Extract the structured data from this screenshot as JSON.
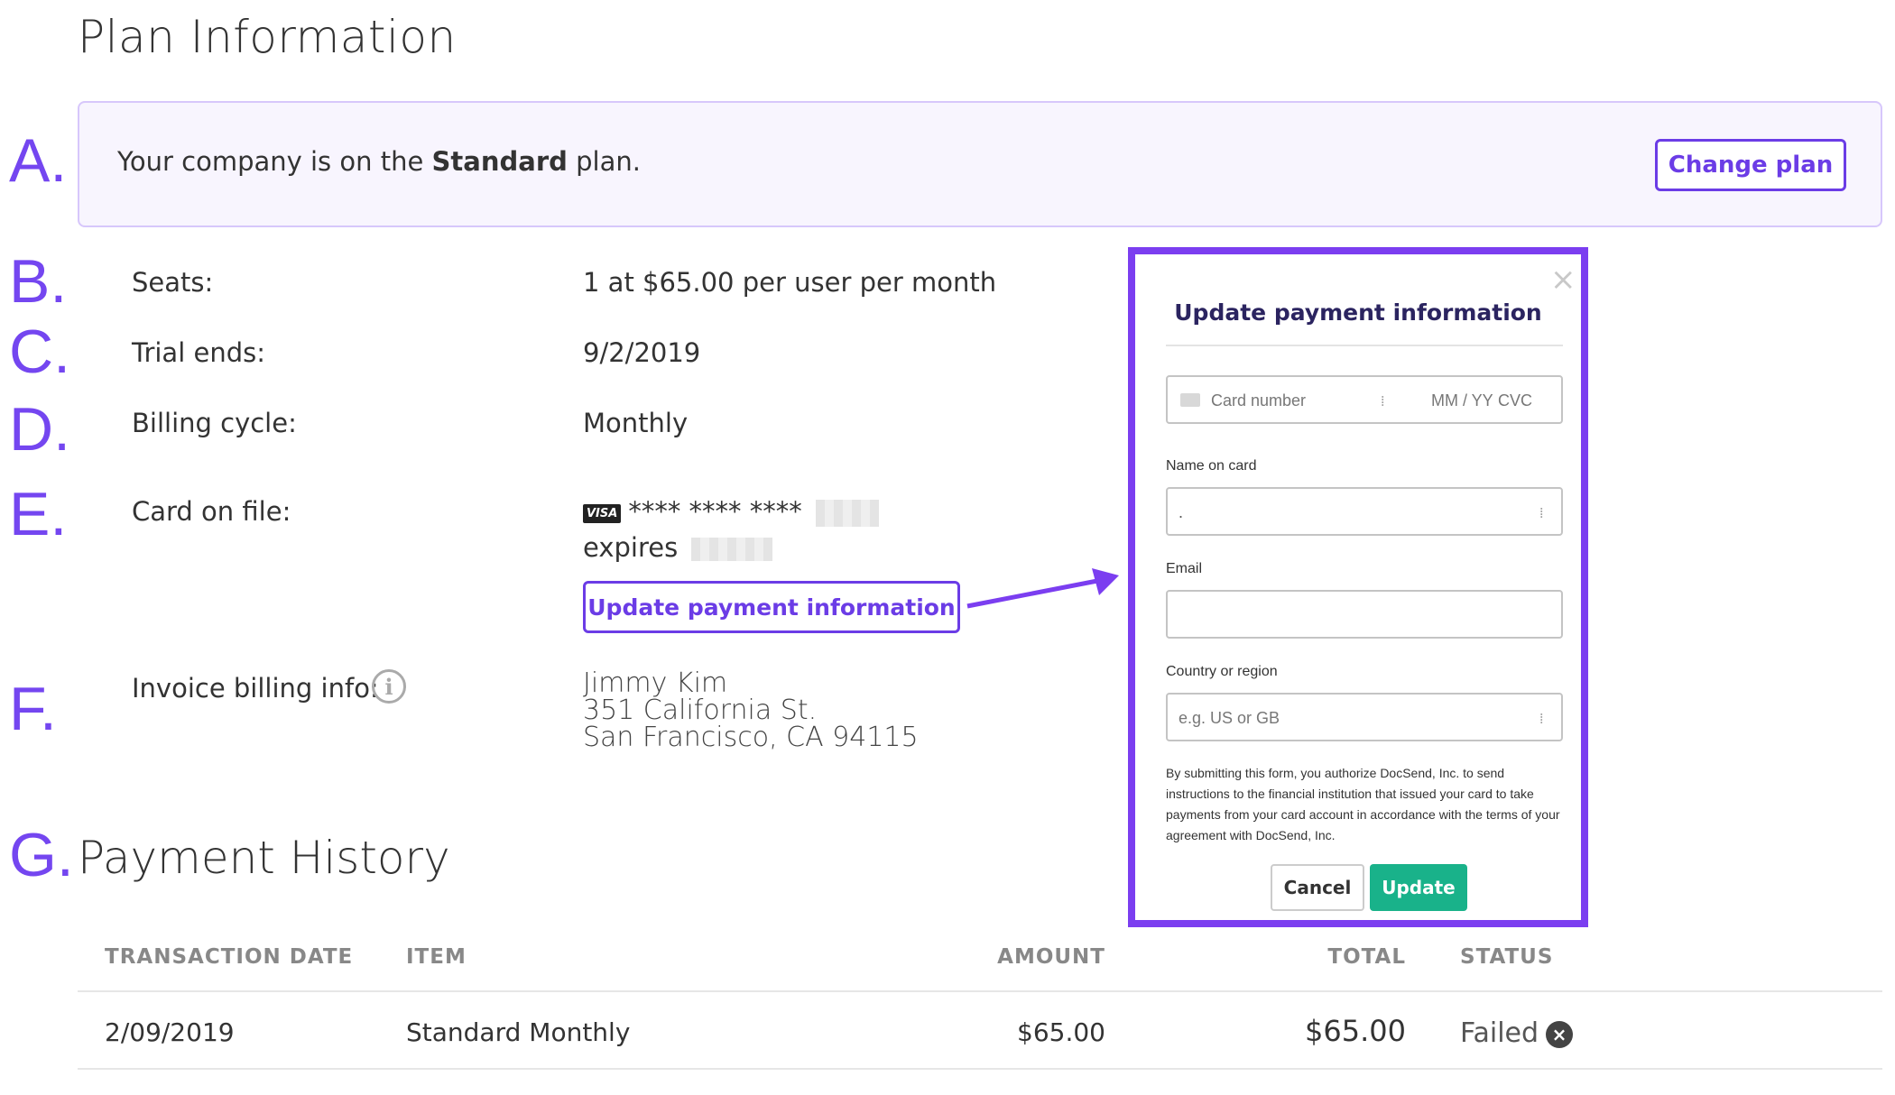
{
  "page_title": "Plan Information",
  "markers": [
    "A.",
    "B.",
    "C.",
    "D.",
    "E.",
    "F.",
    "G."
  ],
  "plan": {
    "text_prefix": "Your company is on the",
    "plan_name": "Standard",
    "text_suffix": "plan.",
    "change_plan_label": "Change plan"
  },
  "details": {
    "seats_label": "Seats:",
    "seats_value": "1 at $65.00 per user per month",
    "trial_label": "Trial ends:",
    "trial_value": "9/2/2019",
    "cycle_label": "Billing cycle:",
    "cycle_value": "Monthly",
    "card_label": "Card on file:",
    "card_brand": "VISA",
    "card_mask": "**** **** ****",
    "expires_label": "expires",
    "update_payment_label": "Update payment information",
    "invoice_label": "Invoice billing info:",
    "info_icon_glyph": "i",
    "address": [
      "Jimmy Kim",
      "351 California St.",
      "San Francisco, CA 94115"
    ]
  },
  "payment_history": {
    "title": "Payment History",
    "columns": [
      "TRANSACTION DATE",
      "ITEM",
      "AMOUNT",
      "TOTAL",
      "STATUS"
    ],
    "rows": [
      {
        "date": "2/09/2019",
        "item": "Standard Monthly",
        "amount": "$65.00",
        "total": "$65.00",
        "status": "Failed"
      }
    ]
  },
  "modal": {
    "title": "Update payment information",
    "close_glyph": "×",
    "card_number_placeholder": "Card number",
    "expiry_placeholder": "MM / YY",
    "cvc_placeholder": "CVC",
    "name_label": "Name on card",
    "name_value": ".",
    "email_label": "Email",
    "email_value": "",
    "country_label": "Country or region",
    "country_placeholder": "e.g. US or GB",
    "consent_text": "By submitting this form, you authorize DocSend, Inc. to send instructions to the financial institution that issued your card to take payments from your card account in accordance with the terms of your agreement with DocSend, Inc.",
    "cancel_label": "Cancel",
    "update_label": "Update"
  },
  "icons": {
    "close_status": "×",
    "keyboard_glyph": "⁞"
  },
  "colors": {
    "accent": "#7446f0",
    "button_purple": "#6b3ce6",
    "banner_bg": "#f8f5fe",
    "update_green": "#19b28a",
    "modal_title": "#2b2460"
  }
}
